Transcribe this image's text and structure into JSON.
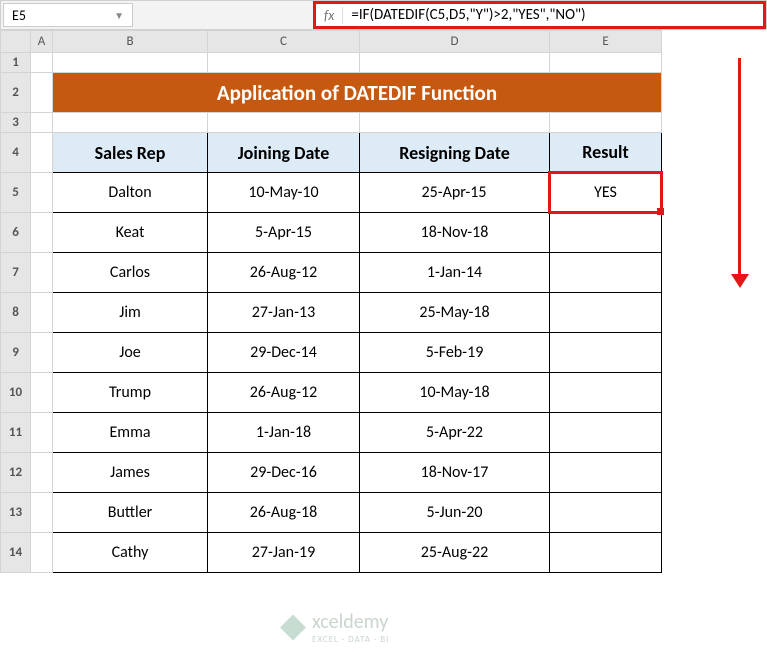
{
  "nameBox": "E5",
  "formula": "=IF(DATEDIF(C5,D5,\"Y\")>2,\"YES\",\"NO\")",
  "fxLabel": "fx",
  "columns": [
    "A",
    "B",
    "C",
    "D",
    "E"
  ],
  "rows": [
    "1",
    "2",
    "3",
    "4",
    "5",
    "6",
    "7",
    "8",
    "9",
    "10",
    "11",
    "12",
    "13",
    "14"
  ],
  "title": "Application of DATEDIF Function",
  "headers": {
    "rep": "Sales Rep",
    "join": "Joining Date",
    "resign": "Resigning Date",
    "result": "Result"
  },
  "data": [
    {
      "rep": "Dalton",
      "join": "10-May-10",
      "resign": "25-Apr-15",
      "result": "YES"
    },
    {
      "rep": "Keat",
      "join": "5-Apr-15",
      "resign": "18-Nov-18",
      "result": ""
    },
    {
      "rep": "Carlos",
      "join": "26-Aug-12",
      "resign": "1-Jan-14",
      "result": ""
    },
    {
      "rep": "Jim",
      "join": "27-Jan-13",
      "resign": "25-May-18",
      "result": ""
    },
    {
      "rep": "Joe",
      "join": "29-Dec-14",
      "resign": "5-Feb-19",
      "result": ""
    },
    {
      "rep": "Trump",
      "join": "26-Aug-12",
      "resign": "10-May-18",
      "result": ""
    },
    {
      "rep": "Emma",
      "join": "1-Jan-18",
      "resign": "5-Apr-22",
      "result": ""
    },
    {
      "rep": "James",
      "join": "29-Dec-16",
      "resign": "18-Nov-17",
      "result": ""
    },
    {
      "rep": "Buttler",
      "join": "26-Aug-18",
      "resign": "5-Jun-20",
      "result": ""
    },
    {
      "rep": "Cathy",
      "join": "27-Jan-19",
      "resign": "25-Aug-22",
      "result": ""
    }
  ],
  "watermark": {
    "brand": "xceldemy",
    "tag": "EXCEL · DATA · BI"
  }
}
